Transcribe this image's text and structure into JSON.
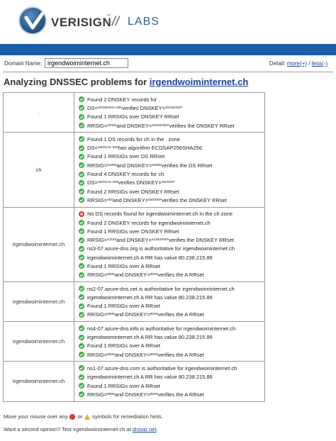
{
  "header": {
    "brand": "VERISIGN",
    "tm": "™",
    "slash": "//",
    "labs": "LABS",
    "colors": {
      "bar": "#1a5ea7",
      "logo": "#2a5d8f"
    }
  },
  "toolbar": {
    "domain_label": "Domain Name:",
    "domain_value": "irgendwoiminternet.ch",
    "detail_label": "Detail:",
    "more": "more(+)",
    "separator": "/",
    "less": "less(-)"
  },
  "title": {
    "prefix": "Analyzing DNSSEC problems for",
    "domain": "irgendwoiminternet.ch"
  },
  "rows": [
    {
      "zone": ".",
      "checks": [
        {
          "status": "ok",
          "parts": [
            [
              "t",
              "Found 2 DNSKEY records for ."
            ]
          ]
        },
        {
          "status": "ok",
          "parts": [
            [
              "t",
              "DS="
            ],
            [
              "s",
              "20326/SHA-256"
            ],
            [
              "t",
              " verifies DNSKEY="
            ],
            [
              "s",
              "20326/SEP"
            ]
          ]
        },
        {
          "status": "ok",
          "parts": [
            [
              "t",
              "Found 1 RRSIGs over DNSKEY RRset"
            ]
          ]
        },
        {
          "status": "ok",
          "parts": [
            [
              "t",
              "RRSIG="
            ],
            [
              "s",
              "20326"
            ],
            [
              "t",
              " and DNSKEY="
            ],
            [
              "s",
              "20326/SEP"
            ],
            [
              "t",
              " verifies the DNSKEY RRset"
            ]
          ]
        }
      ]
    },
    {
      "zone": "ch",
      "checks": [
        {
          "status": "ok",
          "parts": [
            [
              "t",
              "Found 1 DS records for ch in the . zone"
            ]
          ]
        },
        {
          "status": "ok",
          "parts": [
            [
              "t",
              "DS="
            ],
            [
              "s",
              "450/SHA-256"
            ],
            [
              "t",
              " has algorithm ECDSAP256SHA256"
            ]
          ]
        },
        {
          "status": "ok",
          "parts": [
            [
              "t",
              "Found 1 RRSIGs over DS RRset"
            ]
          ]
        },
        {
          "status": "ok",
          "parts": [
            [
              "t",
              "RRSIG="
            ],
            [
              "s",
              "61050"
            ],
            [
              "t",
              " and DNSKEY="
            ],
            [
              "s",
              "61050"
            ],
            [
              "t",
              " verifies the DS RRset"
            ]
          ]
        },
        {
          "status": "ok",
          "parts": [
            [
              "t",
              "Found 4 DNSKEY records for ch"
            ]
          ]
        },
        {
          "status": "ok",
          "parts": [
            [
              "t",
              "DS="
            ],
            [
              "s",
              "450/SHA-256"
            ],
            [
              "t",
              " verifies DNSKEY="
            ],
            [
              "s",
              "450/SEP"
            ]
          ]
        },
        {
          "status": "ok",
          "parts": [
            [
              "t",
              "Found 2 RRSIGs over DNSKEY RRset"
            ]
          ]
        },
        {
          "status": "ok",
          "parts": [
            [
              "t",
              "RRSIG="
            ],
            [
              "s",
              "450"
            ],
            [
              "t",
              " and DNSKEY="
            ],
            [
              "s",
              "450/SEP"
            ],
            [
              "t",
              " verifies the DNSKEY RRset"
            ]
          ]
        }
      ]
    },
    {
      "zone": "irgendwoiminternet.ch",
      "checks": [
        {
          "status": "err",
          "parts": [
            [
              "t",
              "No DS records found for irgendwoiminternet.ch in the ch zone"
            ]
          ]
        },
        {
          "status": "ok",
          "parts": [
            [
              "t",
              "Found 2 DNSKEY records for irgendwoiminternet.ch"
            ]
          ]
        },
        {
          "status": "ok",
          "parts": [
            [
              "t",
              "Found 1 RRSIGs over DNSKEY RRset"
            ]
          ]
        },
        {
          "status": "ok",
          "parts": [
            [
              "t",
              "RRSIG="
            ],
            [
              "s",
              "41183"
            ],
            [
              "t",
              " and DNSKEY="
            ],
            [
              "s",
              "41183/SEP"
            ],
            [
              "t",
              " verifies the DNSKEY RRset"
            ]
          ]
        },
        {
          "status": "ok",
          "parts": [
            [
              "t",
              "ns3-07.azure-dns.org is authoritative for irgendwoiminternet.ch"
            ]
          ]
        },
        {
          "status": "ok",
          "parts": [
            [
              "t",
              "irgendwoiminternet.ch A RR has value 80.238.215.86"
            ]
          ]
        },
        {
          "status": "ok",
          "parts": [
            [
              "t",
              "Found 1 RRSIGs over A RRset"
            ]
          ]
        },
        {
          "status": "ok",
          "parts": [
            [
              "t",
              "RRSIG="
            ],
            [
              "s",
              "8805"
            ],
            [
              "t",
              " and DNSKEY="
            ],
            [
              "s",
              "8805"
            ],
            [
              "t",
              " verifies the A RRset"
            ]
          ]
        }
      ]
    },
    {
      "zone": "irgendwoiminternet.ch",
      "checks": [
        {
          "status": "ok",
          "parts": [
            [
              "t",
              "ns2-07.azure-dns.net is authoritative for irgendwoiminternet.ch"
            ]
          ]
        },
        {
          "status": "ok",
          "parts": [
            [
              "t",
              "irgendwoiminternet.ch A RR has value 80.238.215.86"
            ]
          ]
        },
        {
          "status": "ok",
          "parts": [
            [
              "t",
              "Found 1 RRSIGs over A RRset"
            ]
          ]
        },
        {
          "status": "ok",
          "parts": [
            [
              "t",
              "RRSIG="
            ],
            [
              "s",
              "8805"
            ],
            [
              "t",
              " and DNSKEY="
            ],
            [
              "s",
              "8805"
            ],
            [
              "t",
              " verifies the A RRset"
            ]
          ]
        }
      ]
    },
    {
      "zone": "irgendwoiminternet.ch",
      "checks": [
        {
          "status": "ok",
          "parts": [
            [
              "t",
              "ns4-07.azure-dns.info is authoritative for irgendwoiminternet.ch"
            ]
          ]
        },
        {
          "status": "ok",
          "parts": [
            [
              "t",
              "irgendwoiminternet.ch A RR has value 80.238.215.86"
            ]
          ]
        },
        {
          "status": "ok",
          "parts": [
            [
              "t",
              "Found 1 RRSIGs over A RRset"
            ]
          ]
        },
        {
          "status": "ok",
          "parts": [
            [
              "t",
              "RRSIG="
            ],
            [
              "s",
              "8805"
            ],
            [
              "t",
              " and DNSKEY="
            ],
            [
              "s",
              "8805"
            ],
            [
              "t",
              " verifies the A RRset"
            ]
          ]
        }
      ]
    },
    {
      "zone": "irgendwoiminternet.ch",
      "checks": [
        {
          "status": "ok",
          "parts": [
            [
              "t",
              "ns1-07.azure-dns.com is authoritative for irgendwoiminternet.ch"
            ]
          ]
        },
        {
          "status": "ok",
          "parts": [
            [
              "t",
              "irgendwoiminternet.ch A RR has value 80.238.215.86"
            ]
          ]
        },
        {
          "status": "ok",
          "parts": [
            [
              "t",
              "Found 1 RRSIGs over A RRset"
            ]
          ]
        },
        {
          "status": "ok",
          "parts": [
            [
              "t",
              "RRSIG="
            ],
            [
              "s",
              "8805"
            ],
            [
              "t",
              " and DNSKEY="
            ],
            [
              "s",
              "8805"
            ],
            [
              "t",
              " verifies the A RRset"
            ]
          ]
        }
      ]
    }
  ],
  "footer": {
    "hint_prefix": "Move your mouse over any",
    "hint_or": "or",
    "hint_suffix": "symbols for remediation hints.",
    "second_prefix": "Want a second opinion? Test irgendwoiminternet.ch at",
    "second_link": "dnsviz.net",
    "second_suffix": "."
  }
}
